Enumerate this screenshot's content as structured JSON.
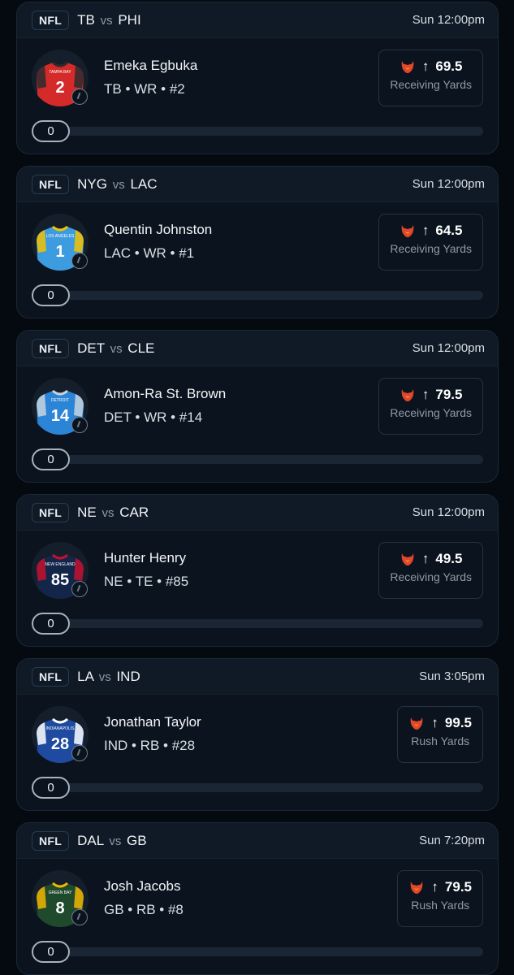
{
  "picks": [
    {
      "league": "NFL",
      "team_a": "TB",
      "vs": "vs",
      "team_b": "PHI",
      "time": "Sun 12:00pm",
      "player": "Emeka Egbuka",
      "meta": "TB • WR • #2",
      "jersey_number": "2",
      "jersey_text": "TAMPA BAY",
      "jersey_color": "#d42a2a",
      "jersey_trim": "#2b2b2b",
      "number_color": "#ffffff",
      "direction_icon": "arrow-up-icon",
      "arrow": "↑",
      "line": "69.5",
      "stat": "Receiving Yards",
      "progress_value": "0",
      "progress_fraction": 0
    },
    {
      "league": "NFL",
      "team_a": "NYG",
      "vs": "vs",
      "team_b": "LAC",
      "time": "Sun 12:00pm",
      "player": "Quentin Johnston",
      "meta": "LAC • WR • #1",
      "jersey_number": "1",
      "jersey_text": "LOS ANGELES",
      "jersey_color": "#3d9be0",
      "jersey_trim": "#f2c300",
      "number_color": "#ffffff",
      "direction_icon": "arrow-up-icon",
      "arrow": "↑",
      "line": "64.5",
      "stat": "Receiving Yards",
      "progress_value": "0",
      "progress_fraction": 0
    },
    {
      "league": "NFL",
      "team_a": "DET",
      "vs": "vs",
      "team_b": "CLE",
      "time": "Sun 12:00pm",
      "player": "Amon-Ra St. Brown",
      "meta": "DET • WR • #14",
      "jersey_number": "14",
      "jersey_text": "DETROIT",
      "jersey_color": "#2b84d6",
      "jersey_trim": "#c8d3de",
      "number_color": "#ffffff",
      "direction_icon": "arrow-up-icon",
      "arrow": "↑",
      "line": "79.5",
      "stat": "Receiving Yards",
      "progress_value": "0",
      "progress_fraction": 0
    },
    {
      "league": "NFL",
      "team_a": "NE",
      "vs": "vs",
      "team_b": "CAR",
      "time": "Sun 12:00pm",
      "player": "Hunter Henry",
      "meta": "NE • TE • #85",
      "jersey_number": "85",
      "jersey_text": "NEW ENGLAND",
      "jersey_color": "#13264a",
      "jersey_trim": "#c8102e",
      "number_color": "#ffffff",
      "direction_icon": "arrow-up-icon",
      "arrow": "↑",
      "line": "49.5",
      "stat": "Receiving Yards",
      "progress_value": "0",
      "progress_fraction": 0
    },
    {
      "league": "NFL",
      "team_a": "LA",
      "vs": "vs",
      "team_b": "IND",
      "time": "Sun 3:05pm",
      "player": "Jonathan Taylor",
      "meta": "IND • RB • #28",
      "jersey_number": "28",
      "jersey_text": "INDIANAPOLIS",
      "jersey_color": "#1e4aa0",
      "jersey_trim": "#ffffff",
      "number_color": "#ffffff",
      "direction_icon": "arrow-up-icon",
      "arrow": "↑",
      "line": "99.5",
      "stat": "Rush Yards",
      "progress_value": "0",
      "progress_fraction": 0
    },
    {
      "league": "NFL",
      "team_a": "DAL",
      "vs": "vs",
      "team_b": "GB",
      "time": "Sun 7:20pm",
      "player": "Josh Jacobs",
      "meta": "GB • RB • #8",
      "jersey_number": "8",
      "jersey_text": "GREEN BAY",
      "jersey_color": "#1f4a2c",
      "jersey_trim": "#f2b600",
      "number_color": "#ffffff",
      "direction_icon": "arrow-up-icon",
      "arrow": "↑",
      "line": "79.5",
      "stat": "Rush Yards",
      "progress_value": "0",
      "progress_fraction": 0
    }
  ],
  "colors": {
    "background": "#050a10",
    "card": "#0b141e",
    "accent_fire": "#e2462b",
    "accent_flame": "#f7a21b"
  }
}
